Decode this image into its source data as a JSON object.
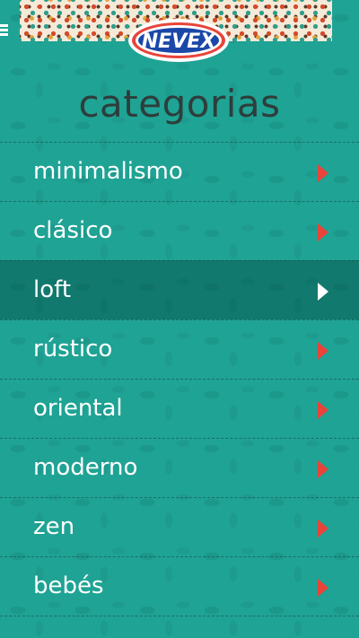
{
  "header": {
    "logo_text": "NEVEX",
    "colors": {
      "brand_red": "#e8443a",
      "brand_blue": "#1b48a8",
      "accent": "#1fa394"
    }
  },
  "page": {
    "title": "categorias"
  },
  "categories": [
    {
      "label": "minimalismo",
      "selected": false
    },
    {
      "label": "clásico",
      "selected": false
    },
    {
      "label": "loft",
      "selected": true
    },
    {
      "label": "rústico",
      "selected": false
    },
    {
      "label": "oriental",
      "selected": false
    },
    {
      "label": "moderno",
      "selected": false
    },
    {
      "label": "zen",
      "selected": false
    },
    {
      "label": "bebés",
      "selected": false
    }
  ],
  "icons": {
    "menu": "hamburger-menu-icon",
    "row_arrow": "chevron-right-icon"
  }
}
